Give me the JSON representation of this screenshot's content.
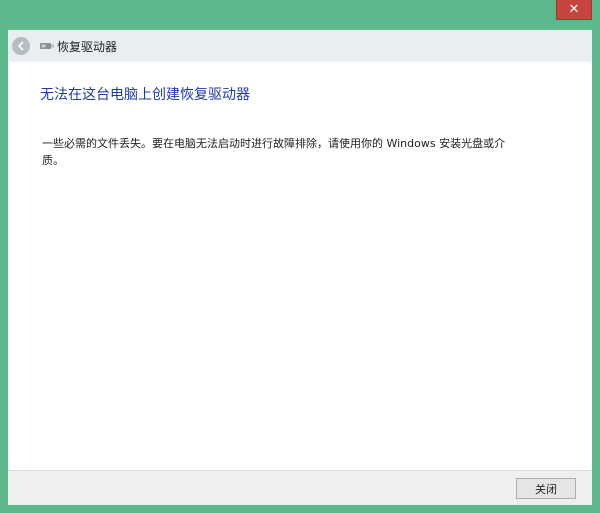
{
  "window": {
    "close_symbol": "✕",
    "accent_color": "#5db88c",
    "close_color": "#c6463f"
  },
  "nav": {
    "back_icon": "back-arrow-icon",
    "drive_icon": "usb-drive-icon",
    "title": "恢复驱动器"
  },
  "main": {
    "heading": "无法在这台电脑上创建恢复驱动器",
    "message": "一些必需的文件丢失。要在电脑无法启动时进行故障排除，请使用你的 Windows 安装光盘或介质。",
    "heading_color": "#1e3aa8"
  },
  "footer": {
    "finish_label": "关闭"
  }
}
